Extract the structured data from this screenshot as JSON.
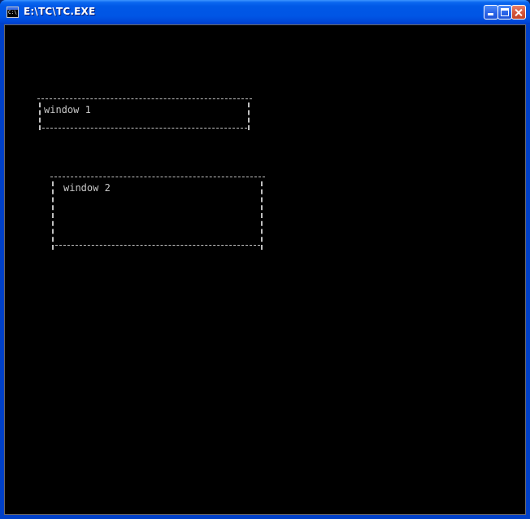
{
  "window": {
    "title": "E:\\TC\\TC.EXE",
    "icon_label": "C:\\"
  },
  "titlebar_buttons": {
    "minimize": "minimize-icon",
    "maximize": "maximize-icon",
    "close": "close-icon"
  },
  "console": {
    "text_windows": [
      {
        "label": "window 1"
      },
      {
        "label": "window 2"
      }
    ]
  },
  "colors": {
    "titlebar": "#0058e6",
    "console_bg": "#000000",
    "console_fg": "#c0c0c0",
    "close_button": "#d4553a"
  }
}
